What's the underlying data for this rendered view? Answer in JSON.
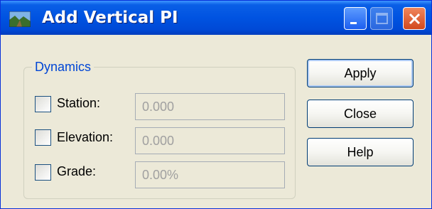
{
  "window": {
    "title": "Add Vertical PI",
    "icon": "landscape-app-icon",
    "controls": {
      "minimize": "minimize-icon",
      "maximize": "maximize-icon",
      "close": "close-icon"
    }
  },
  "dynamics": {
    "label": "Dynamics",
    "fields": [
      {
        "label": "Station:",
        "value": "0.000",
        "checked": false
      },
      {
        "label": "Elevation:",
        "value": "0.000",
        "checked": false
      },
      {
        "label": "Grade:",
        "value": "0.00%",
        "checked": false
      }
    ]
  },
  "buttons": {
    "apply": "Apply",
    "close": "Close",
    "help": "Help"
  },
  "colors": {
    "titlebar": "#0053e1",
    "dialog_bg": "#ece9d8",
    "group_label": "#0046d5",
    "close_button": "#d2491e"
  }
}
